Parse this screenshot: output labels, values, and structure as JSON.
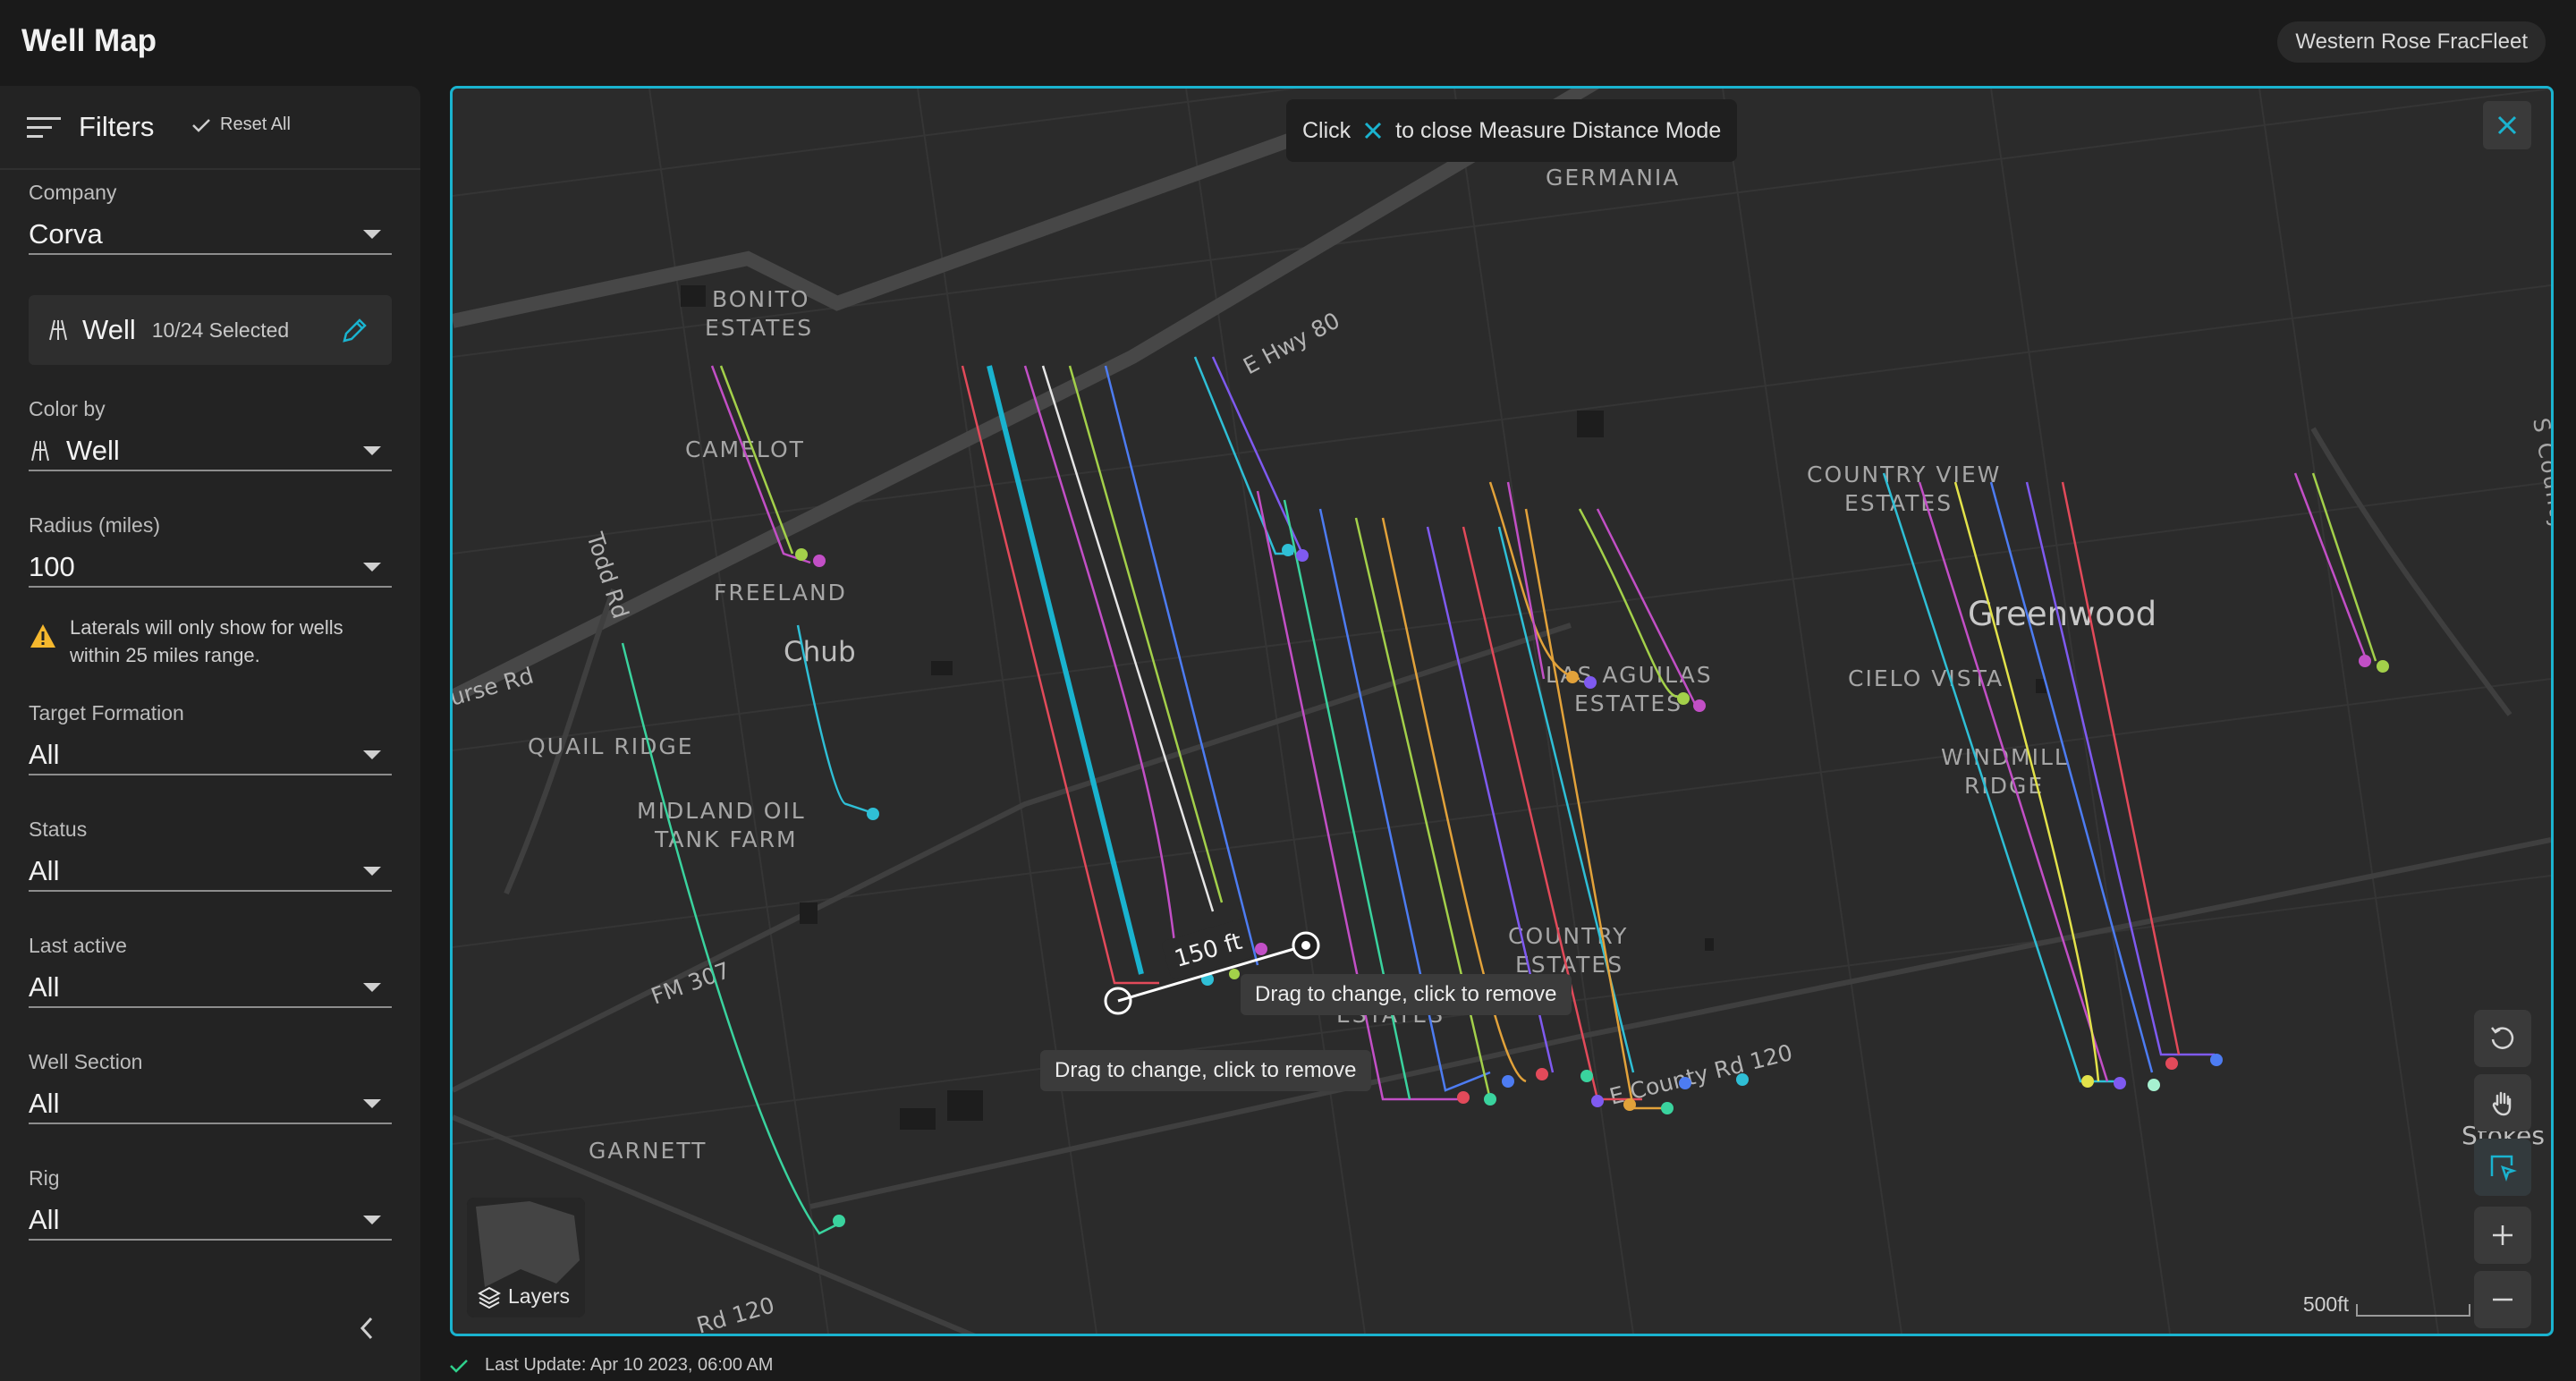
{
  "header": {
    "title": "Well Map",
    "org": "Western Rose FracFleet"
  },
  "sidebar": {
    "filters_title": "Filters",
    "reset_label": "Reset All",
    "company": {
      "label": "Company",
      "value": "Corva"
    },
    "well": {
      "name": "Well",
      "selected": "10/24 Selected"
    },
    "color_by": {
      "label": "Color by",
      "value": "Well"
    },
    "radius": {
      "label": "Radius (miles)",
      "value": "100"
    },
    "warning": "Laterals will only show for wells within 25 miles range.",
    "target_formation": {
      "label": "Target Formation",
      "value": "All"
    },
    "status": {
      "label": "Status",
      "value": "All"
    },
    "last_active": {
      "label": "Last active",
      "value": "All"
    },
    "well_section": {
      "label": "Well Section",
      "value": "All"
    },
    "rig": {
      "label": "Rig",
      "value": "All"
    }
  },
  "map": {
    "banner_click": "Click",
    "banner_text": "to close Measure Distance Mode",
    "measure_label": "150 ft",
    "tooltip_1": "Drag to change, click to remove",
    "tooltip_2": "Drag to change, click to remove",
    "layers_label": "Layers",
    "scale_label": "500ft",
    "places": [
      {
        "name": "GERMANIA"
      },
      {
        "name": "BONITO"
      },
      {
        "name": "ESTATES"
      },
      {
        "name": "CAMELOT"
      },
      {
        "name": "FREELAND"
      },
      {
        "name": "Chub"
      },
      {
        "name": "QUAIL RIDGE"
      },
      {
        "name": "MIDLAND OIL"
      },
      {
        "name": "TANK FARM"
      },
      {
        "name": "GARNETT"
      },
      {
        "name": "COUNTRY VIEW"
      },
      {
        "name": "ESTATES"
      },
      {
        "name": "Greenwood"
      },
      {
        "name": "CIELO VISTA"
      },
      {
        "name": "WINDMILL"
      },
      {
        "name": "RIDGE"
      },
      {
        "name": "LAS AGUILAS"
      },
      {
        "name": "ESTATES"
      },
      {
        "name": "COUNTRY"
      },
      {
        "name": "ESTATES"
      },
      {
        "name": "ESTATES"
      },
      {
        "name": "Stokes"
      },
      {
        "name": "S County"
      }
    ],
    "roads": [
      {
        "name": "E Hwy 80"
      },
      {
        "name": "Todd Rd"
      },
      {
        "name": "urse Rd"
      },
      {
        "name": "FM 307"
      },
      {
        "name": "E County Rd 120"
      },
      {
        "name": "Rd 120"
      }
    ]
  },
  "footer": {
    "last_update": "Last Update: Apr 10 2023, 06:00 AM"
  },
  "colors": {
    "accent": "#1ab3cf",
    "panel": "#232323",
    "map_bg": "#2b2b2b"
  }
}
